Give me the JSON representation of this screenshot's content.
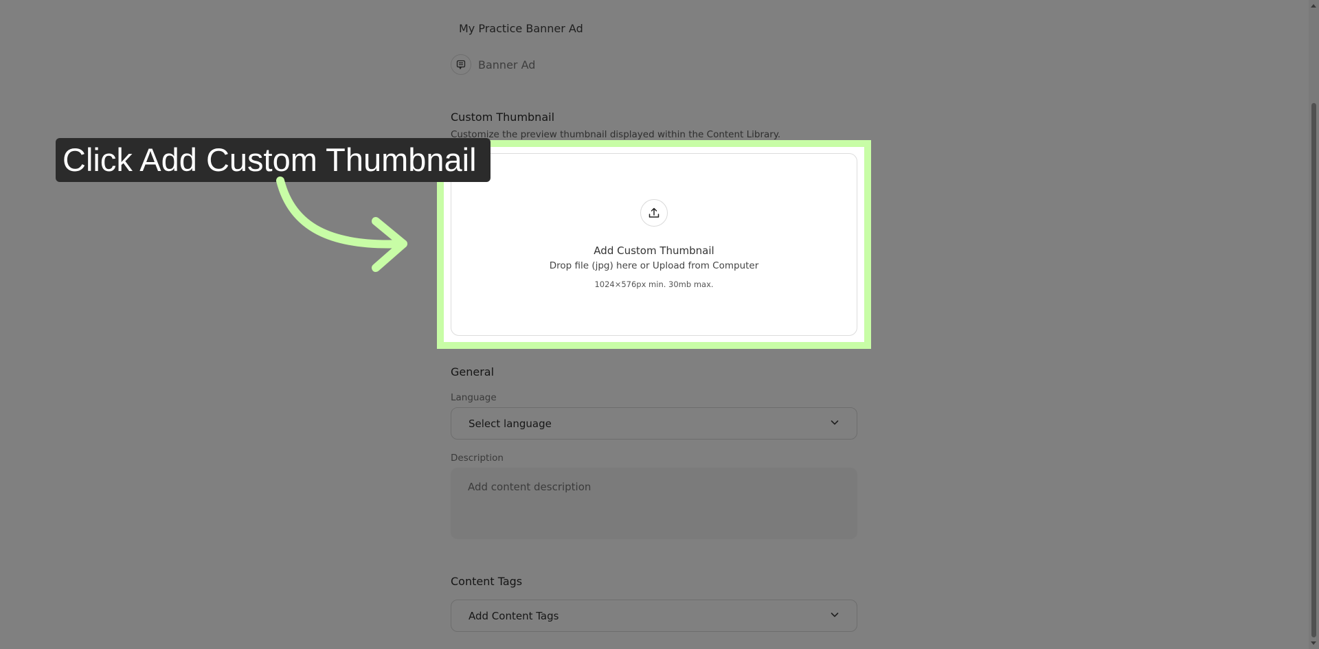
{
  "content": {
    "title": "My Practice Banner Ad",
    "type_label": "Banner Ad",
    "type_icon": "banner-ad-icon"
  },
  "thumbnail_section": {
    "heading": "Custom Thumbnail",
    "description": "Customize the preview thumbnail displayed within the Content Library.",
    "dropzone": {
      "icon": "upload-icon",
      "title": "Add Custom Thumbnail",
      "subtitle": "Drop file (jpg) here or Upload from Computer",
      "hint": "1024×576px min. 30mb max."
    }
  },
  "general_section": {
    "heading": "General",
    "language_label": "Language",
    "language_value": "Select language",
    "description_label": "Description",
    "description_placeholder": "Add content description"
  },
  "tags_section": {
    "heading": "Content Tags",
    "tags_value": "Add Content Tags"
  },
  "tutorial": {
    "callout_text": "Click Add Custom Thumbnail",
    "highlight_color": "#c8fda6",
    "callout_bg": "#2b2b2b"
  }
}
